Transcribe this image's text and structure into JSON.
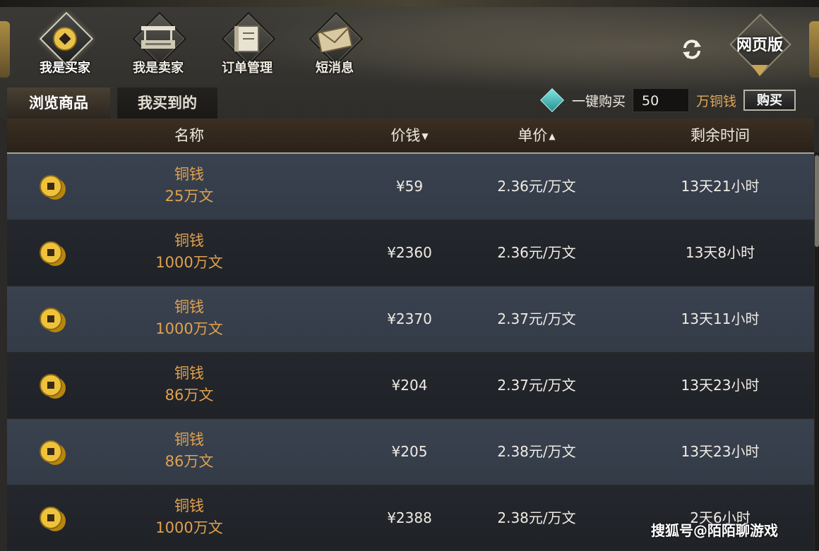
{
  "nav": [
    {
      "id": "buyer",
      "label": "我是买家",
      "icon": "coin-icon",
      "active": true
    },
    {
      "id": "seller",
      "label": "我是卖家",
      "icon": "stall-icon",
      "active": false
    },
    {
      "id": "orders",
      "label": "订单管理",
      "icon": "ledger-icon",
      "active": false
    },
    {
      "id": "messages",
      "label": "短消息",
      "icon": "envelope-icon",
      "active": false
    }
  ],
  "web_label": "网页版",
  "tabs": {
    "browse": "浏览商品",
    "bought": "我买到的"
  },
  "one_click": {
    "label": "一键购买",
    "quantity": "50",
    "unit": "万铜钱",
    "button": "购买"
  },
  "columns": {
    "name": "名称",
    "price": "价钱",
    "unit_price": "单价",
    "time_left": "剩余时间"
  },
  "rows": [
    {
      "item": "铜钱",
      "amount": "25万文",
      "price": "¥59",
      "unit_price": "2.36元/万文",
      "time_left": "13天21小时"
    },
    {
      "item": "铜钱",
      "amount": "1000万文",
      "price": "¥2360",
      "unit_price": "2.36元/万文",
      "time_left": "13天8小时"
    },
    {
      "item": "铜钱",
      "amount": "1000万文",
      "price": "¥2370",
      "unit_price": "2.37元/万文",
      "time_left": "13天11小时"
    },
    {
      "item": "铜钱",
      "amount": "86万文",
      "price": "¥204",
      "unit_price": "2.37元/万文",
      "time_left": "13天23小时"
    },
    {
      "item": "铜钱",
      "amount": "86万文",
      "price": "¥205",
      "unit_price": "2.38元/万文",
      "time_left": "13天23小时"
    },
    {
      "item": "铜钱",
      "amount": "1000万文",
      "price": "¥2388",
      "unit_price": "2.38元/万文",
      "time_left": "2天6小时"
    }
  ],
  "watermark": "搜狐号@陌陌聊游戏",
  "colors": {
    "accent_gold": "#d8b46a",
    "name_orange": "#e0a14f",
    "gem_teal": "#4fc3c0"
  }
}
